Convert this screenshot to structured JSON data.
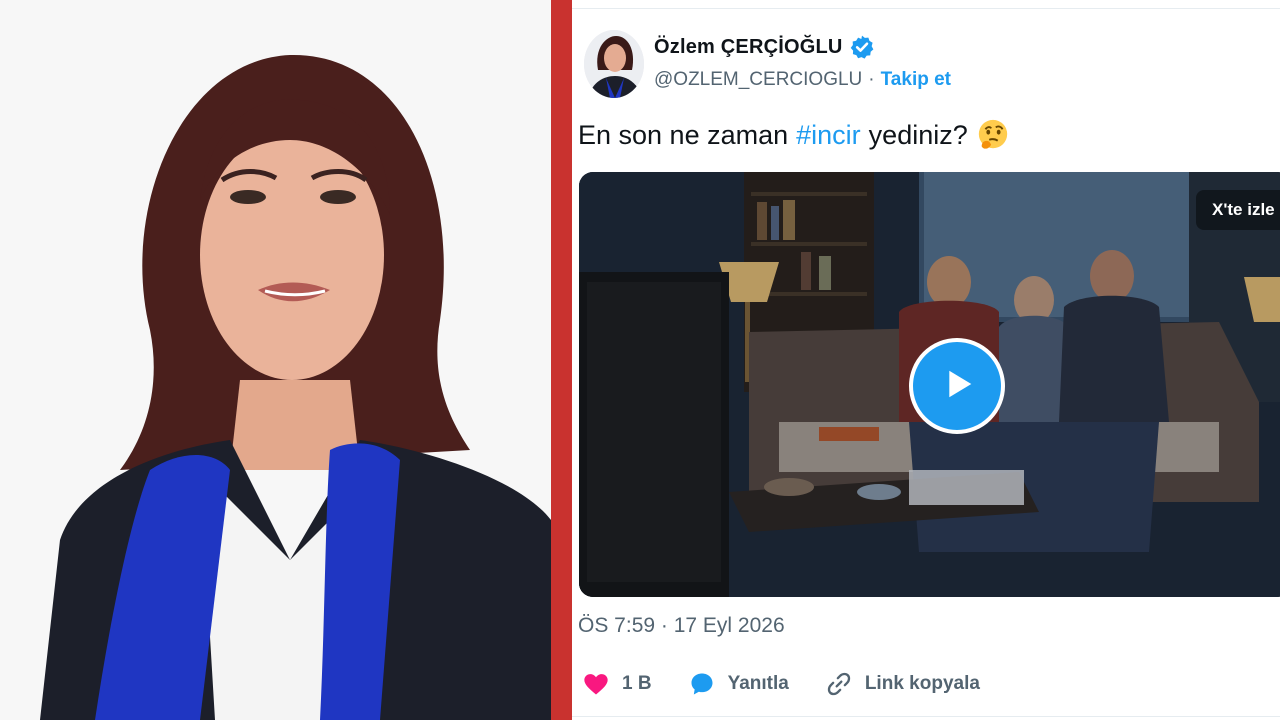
{
  "profile": {
    "display_name": "Özlem ÇERÇİOĞLU",
    "handle": "@OZLEM_CERCIOGLU",
    "separator": "·",
    "follow_label": "Takip et"
  },
  "tweet": {
    "text_before": "En son ne zaman",
    "hashtag": "#incir",
    "text_after": "yediniz?",
    "emoji_icon": "thinking-face-icon",
    "timestamp": "ÖS 7:59 · 17 Eyl 2026"
  },
  "media": {
    "badge_label": "X'te izle",
    "play_icon": "play-icon"
  },
  "actions": {
    "like_count": "1 B",
    "reply_label": "Yanıtla",
    "copy_link_label": "Link kopyala"
  },
  "colors": {
    "accent": "#1d9bf0",
    "divider": "#c9322f",
    "like": "#f91880",
    "blazer_scarf": "#1f36c2"
  }
}
